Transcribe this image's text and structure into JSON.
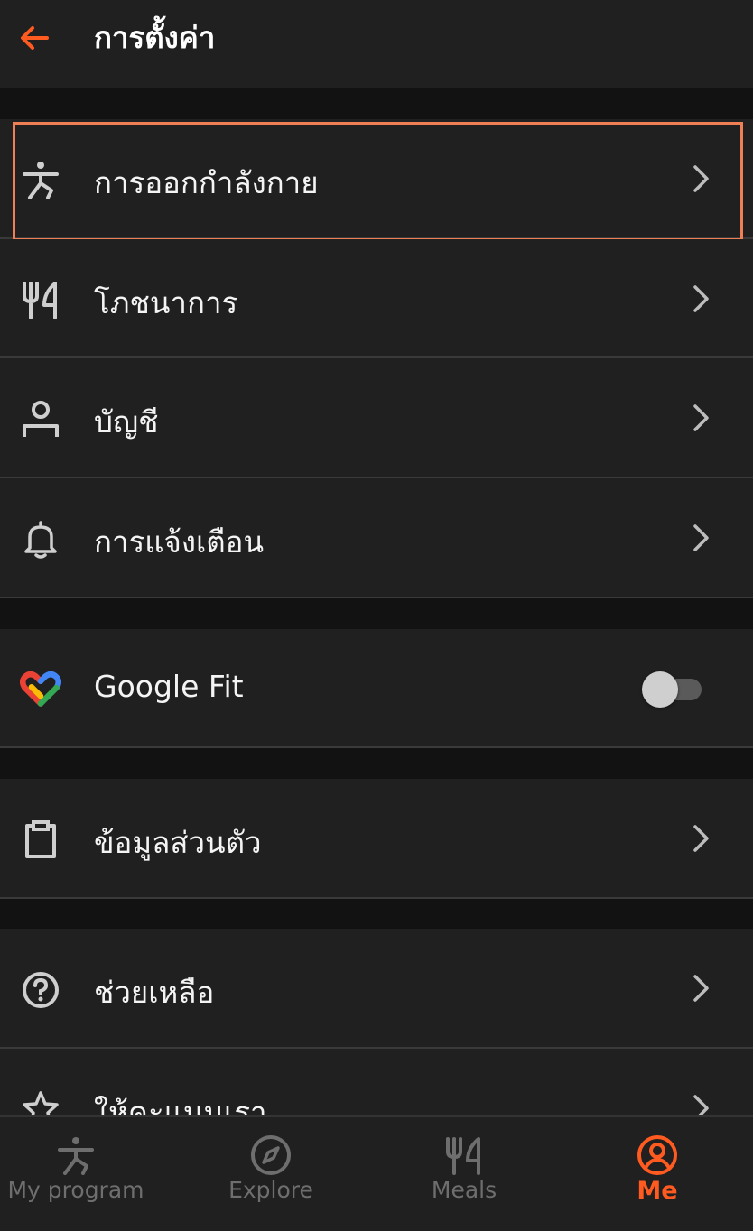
{
  "header": {
    "title": "การตั้งค่า"
  },
  "settings": {
    "exercise": "การออกกำลังกาย",
    "nutrition": "โภชนาการ",
    "account": "บัญชี",
    "notifications": "การแจ้งเตือน",
    "google_fit": "Google Fit",
    "google_fit_enabled": false,
    "personal_info": "ข้อมูลส่วนตัว",
    "help": "ช่วยเหลือ",
    "rate_us": "ให้คะแนนเรา"
  },
  "bottom_nav": {
    "items": [
      {
        "label": "My program",
        "icon": "exercise-figure-icon"
      },
      {
        "label": "Explore",
        "icon": "compass-icon"
      },
      {
        "label": "Meals",
        "icon": "fork-knife-icon"
      },
      {
        "label": "Me",
        "icon": "profile-circle-icon",
        "active": true
      }
    ]
  },
  "colors": {
    "accent": "#ff5a1f",
    "selection_outline": "#ef7f55",
    "surface": "#202020",
    "background": "#121212"
  }
}
